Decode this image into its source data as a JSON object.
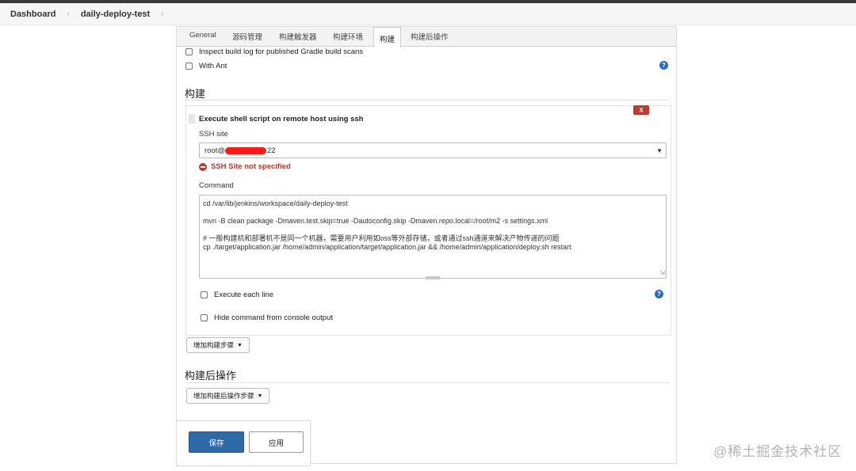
{
  "breadcrumb": {
    "home": "Dashboard",
    "job": "daily-deploy-test",
    "separator": "›"
  },
  "tabs": [
    "General",
    "源码管理",
    "构建触发器",
    "构建环境",
    "构建",
    "构建后操作"
  ],
  "active_tab": "构建",
  "options": {
    "gradle_scans": "Inspect build log for published Gradle build scans",
    "with_ant": "With Ant"
  },
  "build_section": {
    "title": "构建",
    "step": {
      "title": "Execute shell script on remote host using ssh",
      "delete_label": "X",
      "ssh_site_label": "SSH site",
      "ssh_site_prefix": "root@",
      "ssh_site_suffix": "22",
      "error": "SSH Site not specified",
      "command_label": "Command",
      "command_lines": [
        "cd /var/lib/jenkins/workspace/daily-deploy-test",
        "mvn -B clean package -Dmaven.test.skip=true -Dautoconfig.skip -Dmaven.repo.local=/root/m2 -s settings.xml",
        "# 一般构建机和部署机不是同一个机器，需要用户利用如oss等外部存储，或者通过ssh通道来解决产物传递的问题",
        "cp ./target/application.jar /home/admin/application/target/application.jar && /home/admin/application/deploy.sh restart"
      ],
      "execute_each_line": "Execute each line",
      "hide_command": "Hide command from console output"
    },
    "add_step_button": "增加构建步骤"
  },
  "post_build_section": {
    "title": "构建后操作",
    "add_post_step_button": "增加构建后操作步骤"
  },
  "actions": {
    "save": "保存",
    "apply": "应用"
  },
  "help_glyph": "?",
  "watermark": "@稀土掘金技术社区",
  "colors": {
    "primary": "#2e6aa8",
    "error": "#c0392b",
    "help": "#2a6ebb",
    "redaction": "#ff1a1a"
  }
}
